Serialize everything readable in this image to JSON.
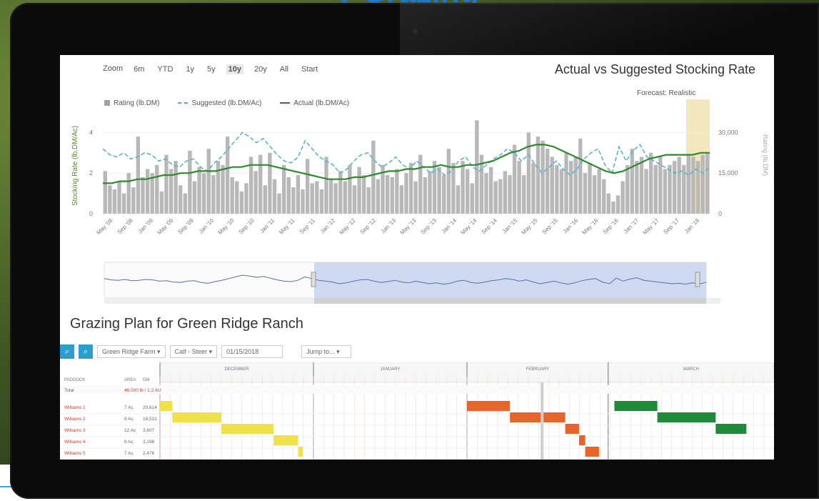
{
  "zoom": {
    "label": "Zoom",
    "options": [
      "6m",
      "YTD",
      "1y",
      "5y",
      "10y",
      "20y",
      "All",
      "Start"
    ],
    "active": "10y"
  },
  "chart_title": "Actual vs Suggested Stocking Rate",
  "forecast_label": "Forecast: Realistic",
  "legend": [
    {
      "name": "Rating (lb.DM)",
      "color": "#a0a0a0",
      "kind": "bar"
    },
    {
      "name": "Suggested (lb.DM/Ac)",
      "color": "#4fb0c6",
      "kind": "dash"
    },
    {
      "name": "Actual (lb.DM/Ac)",
      "color": "#2e7d2e",
      "kind": "line"
    }
  ],
  "colors": {
    "bar": "#b8b8b8",
    "suggested": "#5ab4c9",
    "actual": "#2f8a2f",
    "forecast": "#f2e7bd",
    "navigator": "#c5d3ee",
    "accent": "#2d9ed0"
  },
  "chart_data": {
    "type": "bar",
    "ylabel": "Stocking Rate (lb.DM/Ac)",
    "y2label": "Rating (lb.DM)",
    "y_ticks": [
      "0",
      "2",
      "4"
    ],
    "y2_ticks": [
      "0",
      "15,000",
      "30,000"
    ],
    "ylim": [
      0,
      5
    ],
    "y2lim": [
      0,
      37500
    ],
    "x_labels": [
      "May '08",
      "Sep '08",
      "Jan '09",
      "May '09",
      "Sep '09",
      "Jan '10",
      "May '10",
      "Sep '10",
      "Jan '11",
      "May '11",
      "Sep '11",
      "Jan '12",
      "May '12",
      "Sep '12",
      "Jan '13",
      "May '13",
      "Sep '13",
      "Jan '14",
      "May '14",
      "Sep '14",
      "Jan '15",
      "May '15",
      "Sep '15",
      "Jan '16",
      "May '16",
      "Sep '16",
      "Jan '17",
      "May '17",
      "Sep '17",
      "Jan '18"
    ],
    "bar_values": [
      2.1,
      1.4,
      1.2,
      1.6,
      1.0,
      2.0,
      1.3,
      3.8,
      1.8,
      2.2,
      2.0,
      2.4,
      1.1,
      2.9,
      2.2,
      2.6,
      1.4,
      1.0,
      3.1,
      1.6,
      2.3,
      2.0,
      3.2,
      1.9,
      2.6,
      2.4,
      3.8,
      1.8,
      1.6,
      1.1,
      1.5,
      2.8,
      2.1,
      2.9,
      1.4,
      3.0,
      1.7,
      1.0,
      2.4,
      1.8,
      1.3,
      1.9,
      1.2,
      2.7,
      1.5,
      1.6,
      1.2,
      2.8,
      1.7,
      1.5,
      2.1,
      1.6,
      2.4,
      1.4,
      2.3,
      1.9,
      1.3,
      3.6,
      1.7,
      2.4,
      1.9,
      1.8,
      2.2,
      1.4,
      2.0,
      2.5,
      1.6,
      2.9,
      1.8,
      2.1,
      2.6,
      2.3,
      1.9,
      3.2,
      2.5,
      1.4,
      2.6,
      2.2,
      1.5,
      4.6,
      2.9,
      2.0,
      2.3,
      1.6,
      1.7,
      2.1,
      1.9,
      3.4,
      2.6,
      1.9,
      4.0,
      2.5,
      3.8,
      3.6,
      3.2,
      2.8,
      2.4,
      2.2,
      3.0,
      2.6,
      2.8,
      3.7,
      2.0,
      2.5,
      1.9,
      2.2,
      1.7,
      1.0,
      0.6,
      0.9,
      1.6,
      2.4,
      3.2,
      2.6,
      2.8,
      2.2,
      3.0,
      2.4,
      2.8,
      2.2,
      2.4,
      2.6,
      2.8,
      2.4,
      2.9,
      2.8,
      2.6,
      2.9,
      3.0
    ],
    "suggested": [
      3.2,
      2.9,
      2.8,
      3.0,
      2.7,
      2.8,
      3.0,
      2.9,
      2.6,
      2.7,
      2.4,
      2.3,
      2.6,
      2.7,
      2.3,
      2.1,
      2.5,
      2.8,
      3.2,
      3.6,
      4.0,
      3.8,
      3.5,
      3.7,
      3.3,
      2.9,
      2.6,
      2.5,
      2.8,
      3.6,
      3.2,
      2.8,
      2.6,
      2.4,
      2.0,
      2.2,
      2.6,
      2.9,
      3.0,
      2.6,
      2.3,
      2.5,
      2.8,
      2.4,
      2.2,
      2.6,
      2.3,
      2.0,
      2.2,
      1.9,
      2.1,
      2.6,
      2.8,
      2.3,
      2.1,
      2.4,
      2.7,
      2.9,
      3.2,
      3.0,
      2.6,
      2.9,
      2.4,
      2.0,
      2.3,
      2.6,
      2.2,
      1.9,
      2.2,
      2.7,
      3.0,
      3.2,
      2.4,
      2.0,
      3.3,
      2.6,
      3.1,
      3.4,
      2.8,
      2.6,
      2.4,
      2.2,
      2.0,
      2.1,
      1.9,
      2.2,
      2.0,
      2.3
    ],
    "actual": [
      1.5,
      1.5,
      1.6,
      1.6,
      1.7,
      1.7,
      1.8,
      1.9,
      1.9,
      2.0,
      2.0,
      2.1,
      2.1,
      2.1,
      2.2,
      2.3,
      2.3,
      2.4,
      2.4,
      2.4,
      2.3,
      2.2,
      2.1,
      2.0,
      1.9,
      1.8,
      1.7,
      1.7,
      1.7,
      1.8,
      1.8,
      1.9,
      2.0,
      2.1,
      2.1,
      2.2,
      2.2,
      2.3,
      2.3,
      2.4,
      2.3,
      2.3,
      2.4,
      2.4,
      2.5,
      2.6,
      2.8,
      3.0,
      3.1,
      3.3,
      3.4,
      3.4,
      3.3,
      3.1,
      2.9,
      2.7,
      2.5,
      2.3,
      2.1,
      2.0,
      2.1,
      2.3,
      2.5,
      2.7,
      2.8,
      2.9,
      2.9,
      2.9,
      2.9,
      3.0,
      3.0
    ],
    "forecast_range": [
      124,
      129
    ]
  },
  "grazing": {
    "title": "Grazing Plan for Green Ridge Ranch",
    "zoom_in_icon": "magnifier-plus-icon",
    "zoom_out_icon": "magnifier-minus-icon",
    "ranch_select": "Green Ridge Farm",
    "herd_select": "Calf - Steer",
    "date_field": "01/15/2018",
    "view_select": "Jump to...",
    "months": [
      "DECEMBER",
      "JANUARY",
      "FEBRUARY",
      "MARCH"
    ],
    "columns": [
      "PADDOCK",
      "AREA",
      "DM"
    ],
    "summary_row": {
      "label": "Total",
      "value": "46,000 lb / 1.2 AU"
    },
    "rows": [
      {
        "name": "Williams 1",
        "area": "7 Ac",
        "dm": "20,614"
      },
      {
        "name": "Williams 2",
        "area": "9 Ac",
        "dm": "18,521"
      },
      {
        "name": "Williams 3",
        "area": "12 Ac",
        "dm": "3,607"
      },
      {
        "name": "Williams 4",
        "area": "8 Ac",
        "dm": "3,198"
      },
      {
        "name": "Williams 5",
        "area": "7 Ac",
        "dm": "2,476"
      }
    ],
    "bars": [
      {
        "row": 0,
        "start": 0.0,
        "len": 0.4,
        "color": "#f0e14a"
      },
      {
        "row": 1,
        "start": 0.4,
        "len": 1.6,
        "color": "#f0e14a"
      },
      {
        "row": 2,
        "start": 2.0,
        "len": 1.7,
        "color": "#f0e14a"
      },
      {
        "row": 3,
        "start": 3.7,
        "len": 0.8,
        "color": "#f0e14a"
      },
      {
        "row": 4,
        "start": 4.5,
        "len": 0.15,
        "color": "#f0e14a"
      },
      {
        "row": 0,
        "start": 10.0,
        "len": 1.4,
        "color": "#e8642a"
      },
      {
        "row": 1,
        "start": 11.4,
        "len": 1.8,
        "color": "#e8642a"
      },
      {
        "row": 2,
        "start": 13.2,
        "len": 0.45,
        "color": "#e8642a"
      },
      {
        "row": 3,
        "start": 13.65,
        "len": 0.2,
        "color": "#e8642a"
      },
      {
        "row": 4,
        "start": 13.85,
        "len": 0.45,
        "color": "#e8642a"
      },
      {
        "row": 0,
        "start": 14.8,
        "len": 1.4,
        "color": "#1f8a3a"
      },
      {
        "row": 1,
        "start": 16.2,
        "len": 1.9,
        "color": "#1f8a3a"
      },
      {
        "row": 2,
        "start": 18.1,
        "len": 1.0,
        "color": "#1f8a3a"
      }
    ]
  }
}
